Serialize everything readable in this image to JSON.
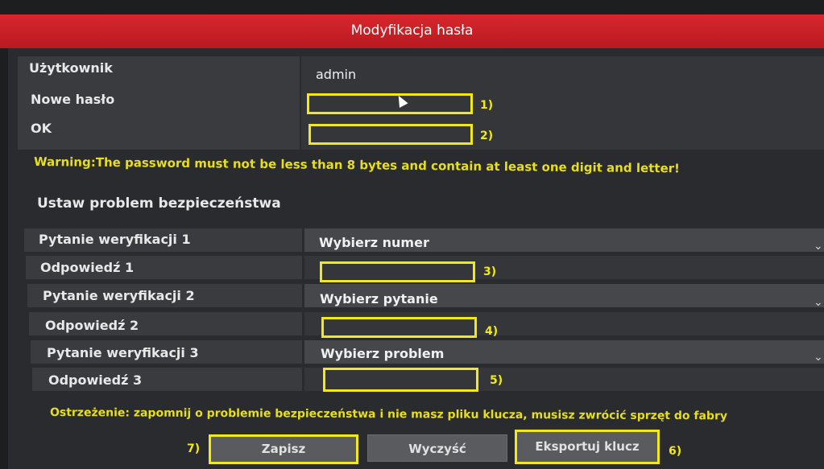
{
  "dialog": {
    "title": "Modyfikacja hasła"
  },
  "user": {
    "label": "Użytkownik",
    "value": "admin",
    "new_password_label": "Nowe hasło",
    "confirm_label": "OK",
    "marker_1": "1)",
    "marker_2": "2)"
  },
  "warning": "Warning:The password must not be less than 8 bytes and contain at least one digit and letter!",
  "security": {
    "section_title": "Ustaw problem bezpieczeństwa",
    "q1_label": "Pytanie weryfikacji 1",
    "q1_value": "Wybierz numer",
    "a1_label": "Odpowiedź 1",
    "marker_3": "3)",
    "q2_label": "Pytanie weryfikacji 2",
    "q2_value": "Wybierz pytanie",
    "a2_label": "Odpowiedź 2",
    "marker_4": "4)",
    "q3_label": "Pytanie weryfikacji 3",
    "q3_value": "Wybierz problem",
    "a3_label": "Odpowiedź 3",
    "marker_5": "5)"
  },
  "notice": "Ostrzeżenie: zapomnij o problemie bezpieczeństwa i nie masz pliku klucza, musisz zwrócić sprzęt do fabry",
  "buttons": {
    "save": "Zapisz",
    "clear": "Wyczyść",
    "export": "Eksportuj klucz",
    "marker_7": "7)",
    "marker_6": "6)"
  },
  "icons": {
    "dropdown": "chevron-down-icon",
    "cursor": "mouse-pointer-icon"
  }
}
